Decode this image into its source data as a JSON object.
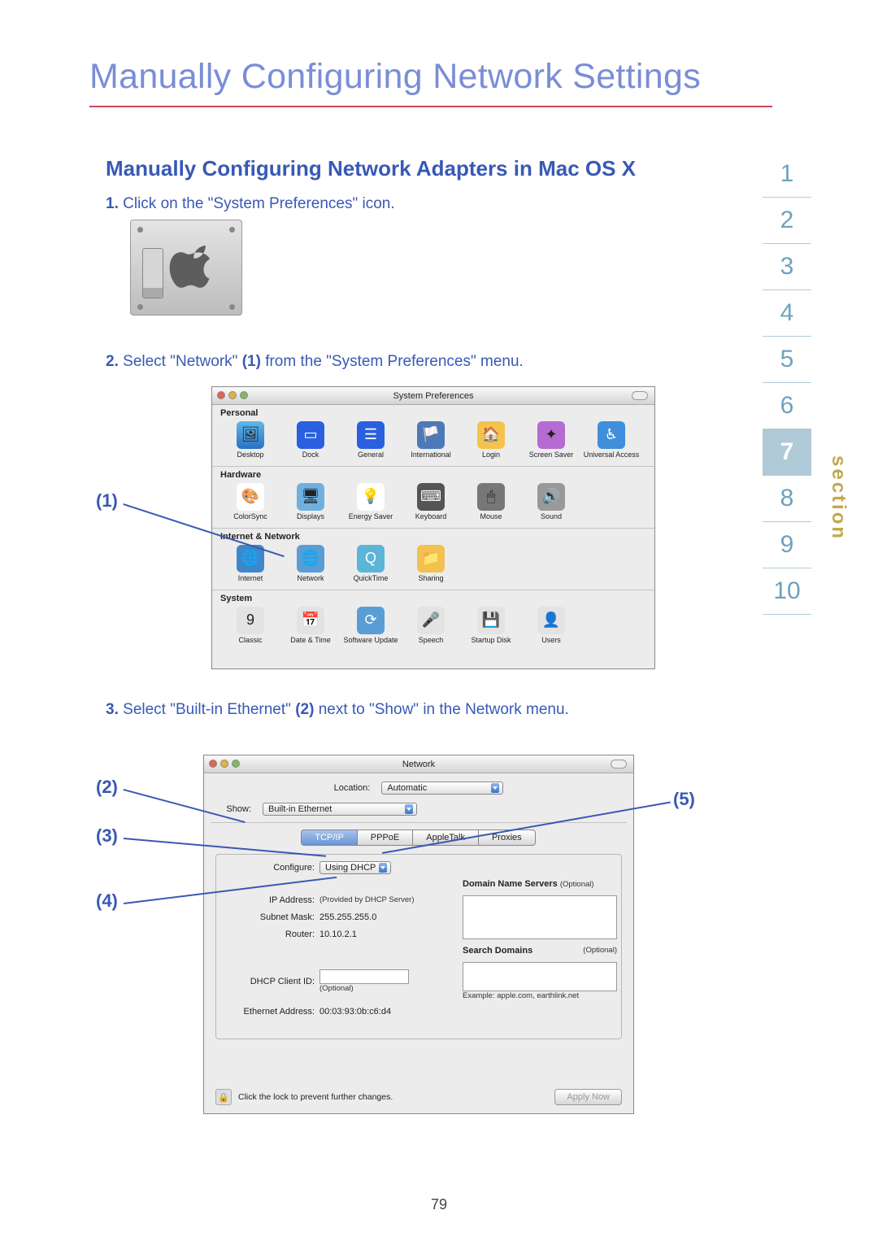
{
  "pageTitle": "Manually Configuring Network Settings",
  "subtitle": "Manually Configuring Network Adapters in Mac OS X",
  "steps": {
    "s1": {
      "num": "1.",
      "text": "Click on the \"System Preferences\" icon."
    },
    "s2": {
      "num": "2.",
      "prefix": "Select \"Network\" ",
      "bold": "(1)",
      "suffix": " from the \"System Preferences\" menu."
    },
    "s3": {
      "num": "3.",
      "prefix": "Select \"Built-in Ethernet\" ",
      "bold": "(2)",
      "suffix": " next to \"Show\" in the Network menu."
    }
  },
  "callouts": {
    "c1": "(1)",
    "c2": "(2)",
    "c3": "(3)",
    "c4": "(4)",
    "c5": "(5)"
  },
  "sectionNav": {
    "label": "section",
    "current": "7",
    "items": [
      "1",
      "2",
      "3",
      "4",
      "5",
      "6",
      "7",
      "8",
      "9",
      "10"
    ]
  },
  "pageNumber": "79",
  "sysprefs": {
    "title": "System Preferences",
    "h1": "Personal",
    "personal": [
      "Desktop",
      "Dock",
      "General",
      "International",
      "Login",
      "Screen Saver",
      "Universal Access"
    ],
    "h2": "Hardware",
    "hardware": [
      "ColorSync",
      "Displays",
      "Energy Saver",
      "Keyboard",
      "Mouse",
      "Sound"
    ],
    "h3": "Internet & Network",
    "internet": [
      "Internet",
      "Network",
      "QuickTime",
      "Sharing"
    ],
    "h4": "System",
    "system": [
      "Classic",
      "Date & Time",
      "Software Update",
      "Speech",
      "Startup Disk",
      "Users"
    ]
  },
  "network": {
    "title": "Network",
    "locationLabel": "Location:",
    "locationValue": "Automatic",
    "showLabel": "Show:",
    "showValue": "Built-in Ethernet",
    "tabs": [
      "TCP/IP",
      "PPPoE",
      "AppleTalk",
      "Proxies"
    ],
    "configureLabel": "Configure:",
    "configureValue": "Using DHCP",
    "dnsLabel": "Domain Name Servers",
    "dnsOptional": "(Optional)",
    "ipLabel": "IP Address:",
    "ipNote": "(Provided by DHCP Server)",
    "subnetLabel": "Subnet Mask:",
    "subnetValue": "255.255.255.0",
    "routerLabel": "Router:",
    "routerValue": "10.10.2.1",
    "searchDomainsLabel": "Search Domains",
    "searchDomainsOptional": "(Optional)",
    "dhcpLabel": "DHCP Client ID:",
    "dhcpOptional": "(Optional)",
    "exampleText": "Example: apple.com, earthlink.net",
    "ethLabel": "Ethernet Address:",
    "ethValue": "00:03:93:0b:c6:d4",
    "lockText": "Click the lock to prevent further changes.",
    "applyLabel": "Apply Now"
  }
}
